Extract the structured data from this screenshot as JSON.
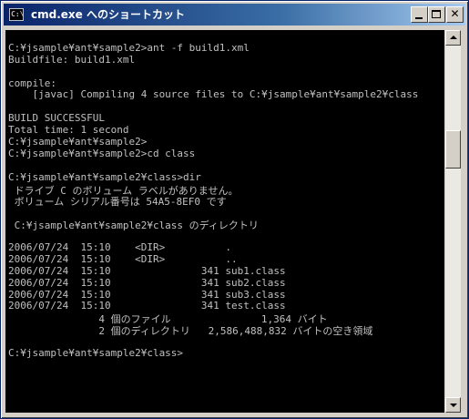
{
  "window": {
    "title": "cmd.exe へのショートカット",
    "icon": "cmd-icon",
    "icon_text": "C:\\"
  },
  "console": {
    "lines": [
      "",
      "C:¥jsample¥ant¥sample2>ant -f build1.xml",
      "Buildfile: build1.xml",
      "",
      "compile:",
      "    [javac] Compiling 4 source files to C:¥jsample¥ant¥sample2¥class",
      "",
      "BUILD SUCCESSFUL",
      "Total time: 1 second",
      "C:¥jsample¥ant¥sample2>",
      "C:¥jsample¥ant¥sample2>cd class",
      "",
      "C:¥jsample¥ant¥sample2¥class>dir",
      " ドライブ C のボリューム ラベルがありません。",
      " ボリューム シリアル番号は 54A5-8EF0 です",
      "",
      " C:¥jsample¥ant¥sample2¥class のディレクトリ",
      "",
      "2006/07/24  15:10    <DIR>          .",
      "2006/07/24  15:10    <DIR>          ..",
      "2006/07/24  15:10               341 sub1.class",
      "2006/07/24  15:10               341 sub2.class",
      "2006/07/24  15:10               341 sub3.class",
      "2006/07/24  15:10               341 test.class",
      "               4 個のファイル               1,364 バイト",
      "               2 個のディレクトリ   2,586,488,832 バイトの空き領域",
      "",
      "C:¥jsample¥ant¥sample2¥class>",
      "",
      "",
      "",
      ""
    ]
  },
  "scrollbar": {
    "position_fraction": 0.27
  }
}
